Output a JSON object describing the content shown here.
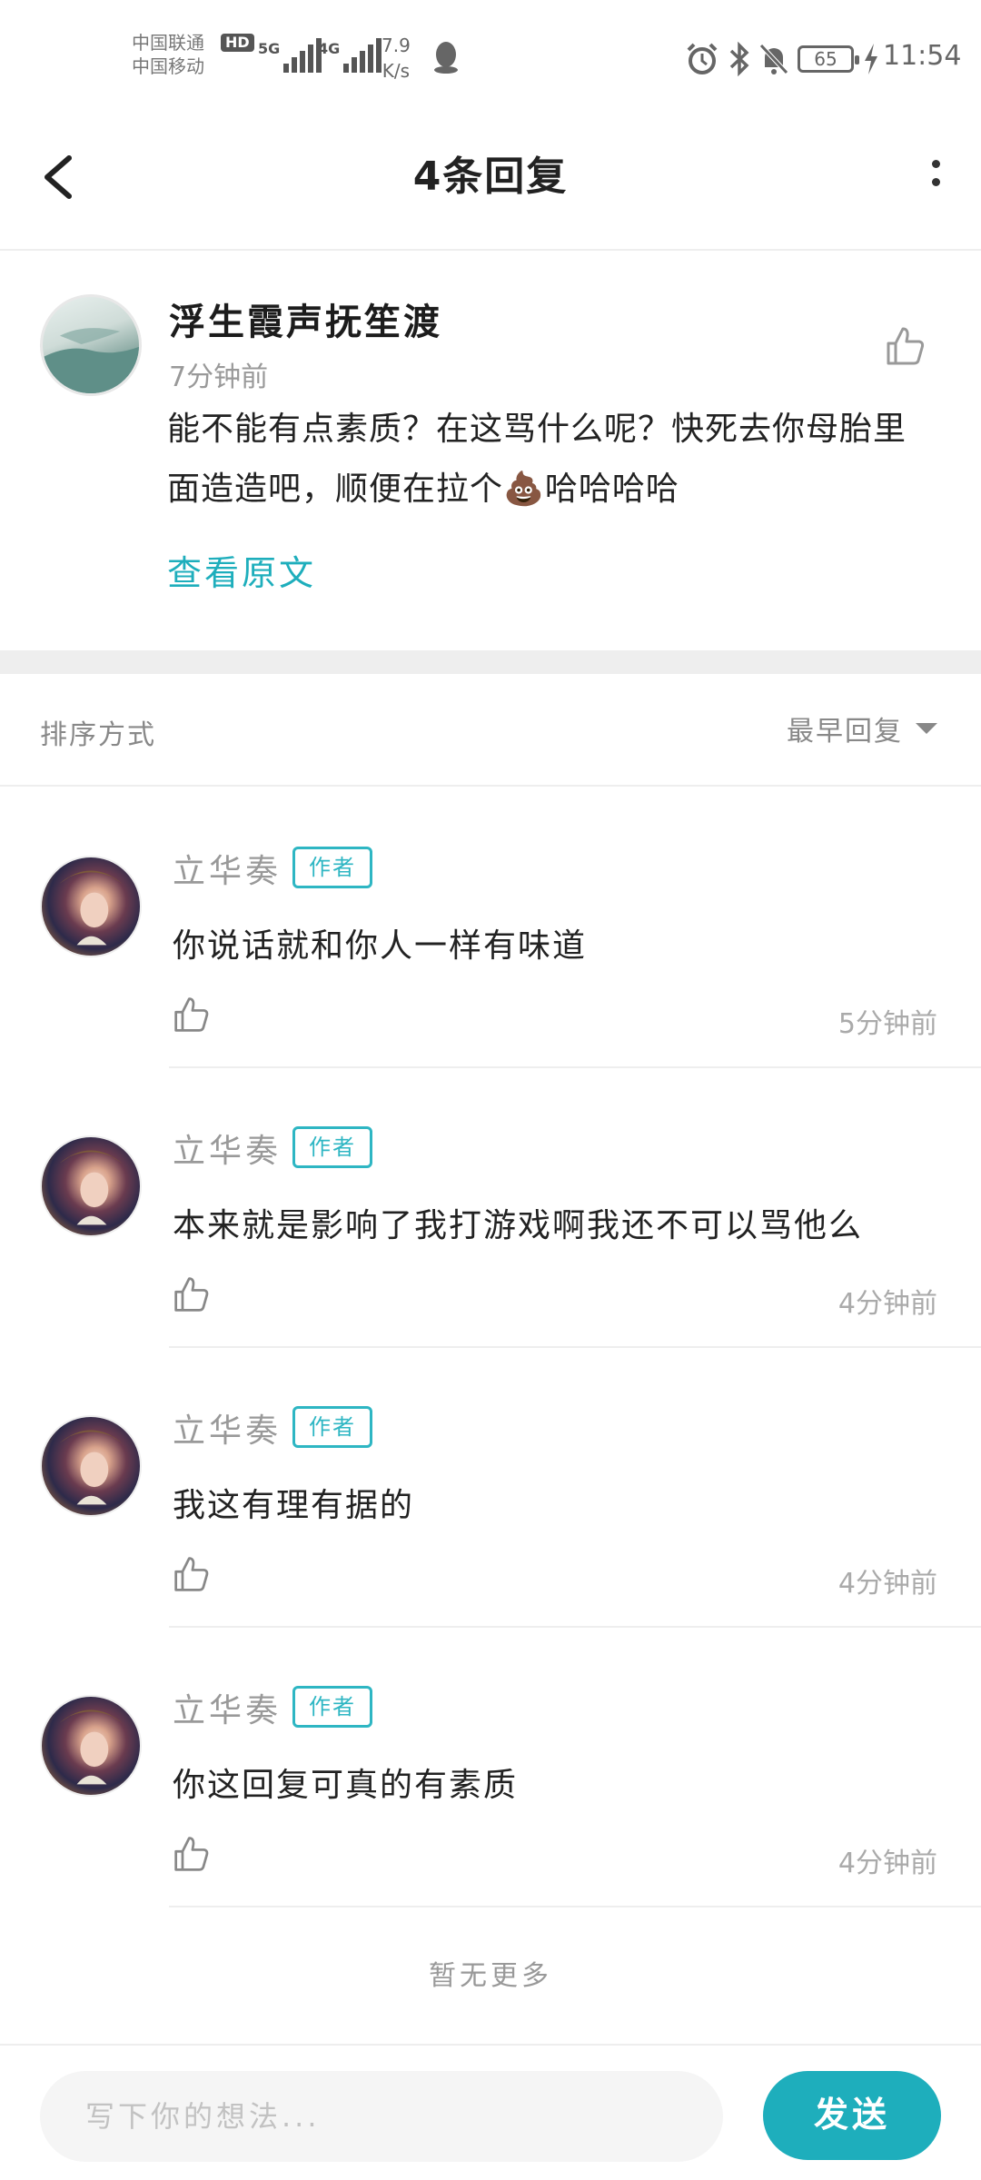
{
  "status_bar": {
    "carrier_1": "中国联通",
    "carrier_2": "中国移动",
    "hd_badge": "HD",
    "signal_1_label": "5G",
    "signal_2_label": "4G",
    "net_speed_value": "7.9",
    "net_speed_unit": "K/s",
    "battery": "65",
    "time": "11:54"
  },
  "header": {
    "title": "4条回复"
  },
  "original_comment": {
    "author": "浮生霞声抚笙渡",
    "time": "7分钟前",
    "content": "能不能有点素质？在这骂什么呢？快死去你母胎里面造造吧，顺便在拉个💩哈哈哈哈",
    "view_original": "查看原文"
  },
  "sort": {
    "label": "排序方式",
    "selected": "最早回复"
  },
  "replies": [
    {
      "author": "立华奏",
      "badge": "作者",
      "text": "你说话就和你人一样有味道",
      "time": "5分钟前"
    },
    {
      "author": "立华奏",
      "badge": "作者",
      "text": "本来就是影响了我打游戏啊我还不可以骂他么",
      "time": "4分钟前"
    },
    {
      "author": "立华奏",
      "badge": "作者",
      "text": "我这有理有据的",
      "time": "4分钟前"
    },
    {
      "author": "立华奏",
      "badge": "作者",
      "text": "你这回复可真的有素质",
      "time": "4分钟前"
    }
  ],
  "footer": {
    "no_more": "暂无更多"
  },
  "input_bar": {
    "placeholder": "写下你的想法...",
    "send_label": "发送"
  },
  "colors": {
    "accent": "#1eaebc",
    "divider": "#eeeeee",
    "muted_text": "#999999"
  }
}
